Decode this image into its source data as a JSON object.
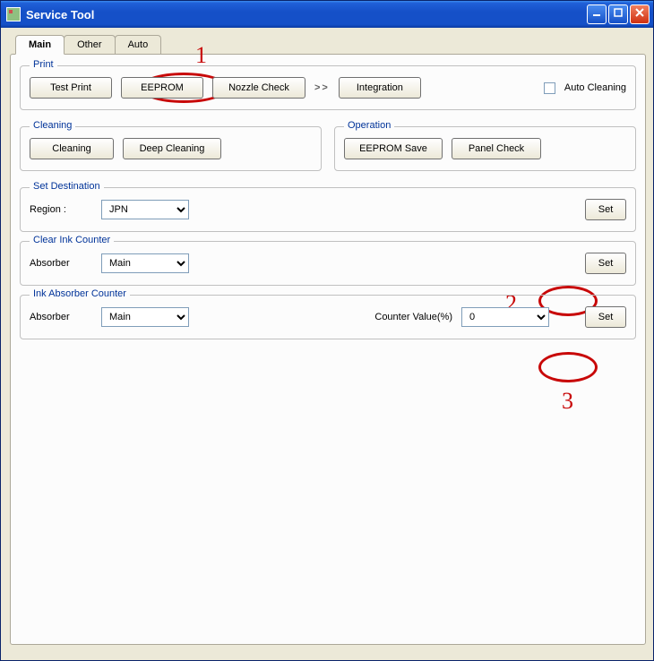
{
  "window": {
    "title": "Service Tool"
  },
  "tabs": {
    "main": "Main",
    "other": "Other",
    "auto": "Auto"
  },
  "print": {
    "legend": "Print",
    "test_print": "Test Print",
    "eeprom": "EEPROM",
    "nozzle_check": "Nozzle Check",
    "integration": "Integration",
    "auto_cleaning": "Auto Cleaning"
  },
  "cleaning": {
    "legend": "Cleaning",
    "cleaning": "Cleaning",
    "deep_cleaning": "Deep Cleaning"
  },
  "operation": {
    "legend": "Operation",
    "eeprom_save": "EEPROM Save",
    "panel_check": "Panel Check"
  },
  "destination": {
    "legend": "Set Destination",
    "region_label": "Region :",
    "region_value": "JPN",
    "set": "Set"
  },
  "clear_ink": {
    "legend": "Clear Ink Counter",
    "absorber_label": "Absorber",
    "absorber_value": "Main",
    "set": "Set"
  },
  "ink_absorber": {
    "legend": "Ink Absorber Counter",
    "absorber_label": "Absorber",
    "absorber_value": "Main",
    "counter_label": "Counter Value(%)",
    "counter_value": "0",
    "set": "Set"
  },
  "annotations": {
    "n1": "1",
    "n2": "2",
    "n3": "3"
  },
  "arrows_sep": ">>"
}
